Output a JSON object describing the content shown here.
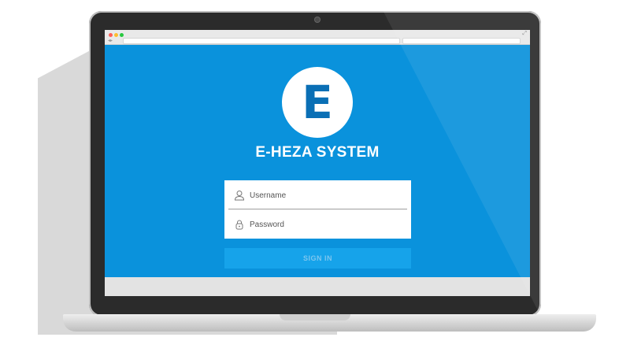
{
  "app": {
    "logo_letter": "E",
    "title": "E-HEZA SYSTEM"
  },
  "login": {
    "username_placeholder": "Username",
    "password_placeholder": "Password",
    "signin_label": "SIGN IN"
  },
  "colors": {
    "background": "#0a92dc",
    "logo_text": "#0a6fb5",
    "button": "#16a3ea"
  },
  "icons": {
    "username": "user-icon",
    "password": "lock-icon"
  }
}
